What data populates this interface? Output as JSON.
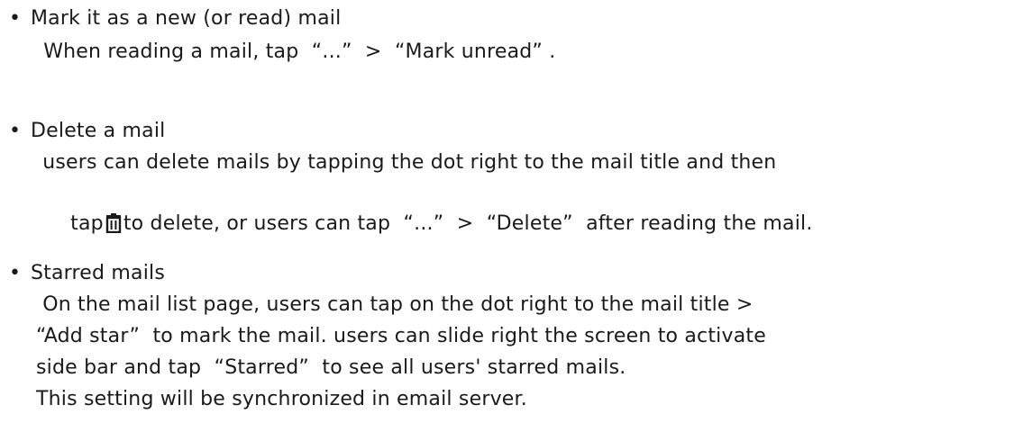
{
  "sections": [
    {
      "bullet": "•",
      "title": "Mark it as a new (or read) mail",
      "lines": [
        " When reading a mail, tap  “...”  >  “Mark unread” ."
      ]
    },
    {
      "bullet": "•",
      "title": "Delete a mail",
      "line1": " users can delete mails by tapping the dot right to the mail title and then",
      "line2_before": "tap",
      "line2_icon": "trash-icon",
      "line2_after": "to delete, or users can tap  “...”  >  “Delete”  after reading the mail."
    },
    {
      "bullet": "•",
      "title": "Starred mails",
      "lines": [
        " On the mail list page, users can tap on the dot right to the mail title >",
        "“Add star”  to mark the mail. users can slide right the screen to activate",
        "side bar and tap  “Starred”  to see all users' starred mails.",
        "This setting will be synchronized in email server."
      ]
    }
  ]
}
